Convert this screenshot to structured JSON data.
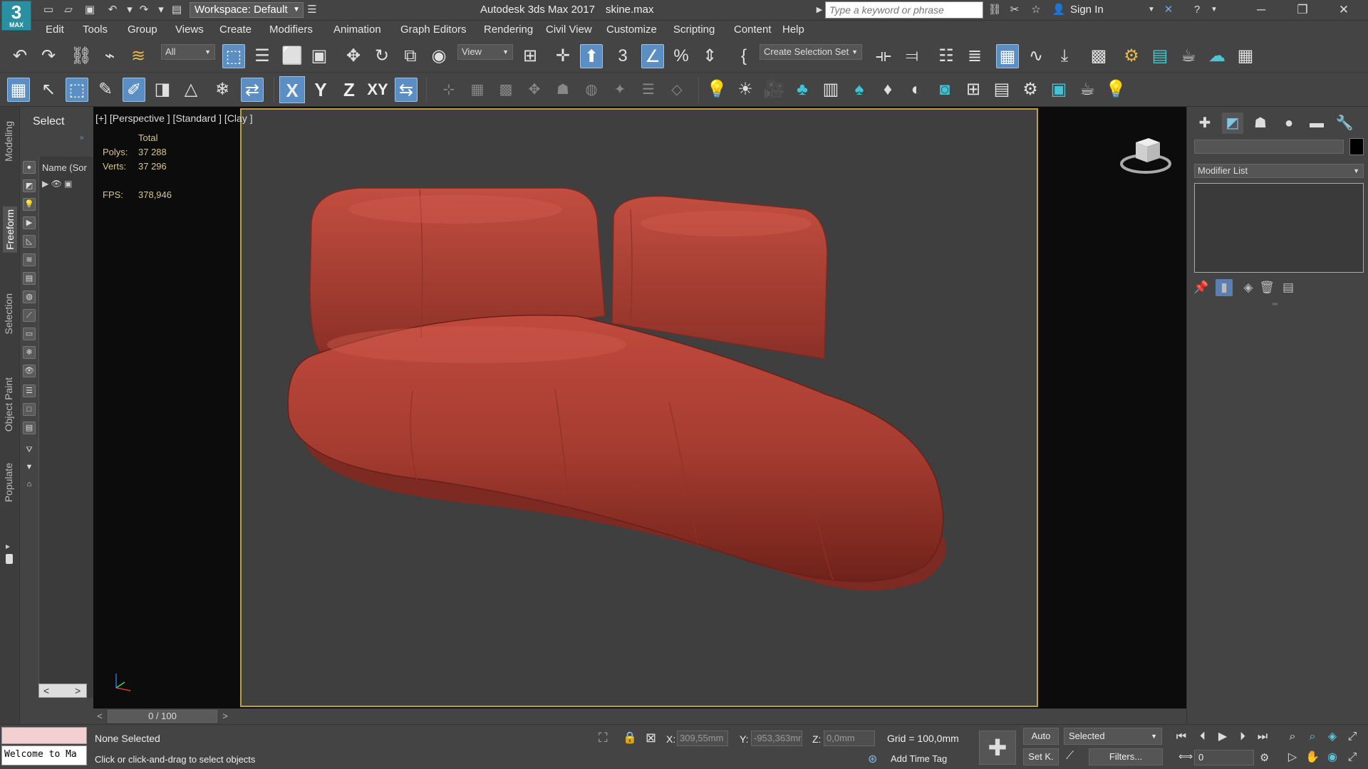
{
  "titlebar": {
    "logo_text": "3",
    "logo_sub": "MAX",
    "workspace": "Workspace: Default",
    "app_title": "Autodesk 3ds Max 2017",
    "file_name": "skine.max",
    "search_placeholder": "Type a keyword or phrase",
    "sign_in": "Sign In"
  },
  "menu": [
    "Edit",
    "Tools",
    "Group",
    "Views",
    "Create",
    "Modifiers",
    "Animation",
    "Graph Editors",
    "Rendering",
    "Civil View",
    "Customize",
    "Scripting",
    "Content",
    "Help"
  ],
  "toolbar": {
    "selection_filter": "All",
    "ref_coord": "View",
    "selection_set": "Create Selection Set",
    "axis": [
      "X",
      "Y",
      "Z",
      "XY"
    ]
  },
  "ribbon_tabs": [
    "Modeling",
    "Freeform",
    "Selection",
    "Object Paint",
    "Populate"
  ],
  "explorer": {
    "select_label": "Select",
    "name_column": "Name (Sor"
  },
  "viewport": {
    "label": "[+] [Perspective ] [Standard ] [Clay ]",
    "stats": {
      "header": "Total",
      "polys_label": "Polys:",
      "polys": "37 288",
      "verts_label": "Verts:",
      "verts": "37 296",
      "fps_label": "FPS:",
      "fps": "378,946"
    },
    "model_color": "#b8463a"
  },
  "command_panel": {
    "modifier_list": "Modifier List"
  },
  "time_slider": {
    "frame": "0 / 100"
  },
  "status": {
    "selection": "None Selected",
    "prompt": "Click or click-and-drag to select objects",
    "maxscript_welcome": "Welcome to Ma",
    "x_label": "X:",
    "x_value": "309,55mm",
    "y_label": "Y:",
    "y_value": "-953,363mr",
    "z_label": "Z:",
    "z_value": "0,0mm",
    "grid": "Grid = 100,0mm",
    "add_time_tag": "Add Time Tag",
    "auto_key": "Auto",
    "set_key": "Set K.",
    "key_mode": "Selected",
    "filters": "Filters...",
    "current_frame": "0"
  }
}
